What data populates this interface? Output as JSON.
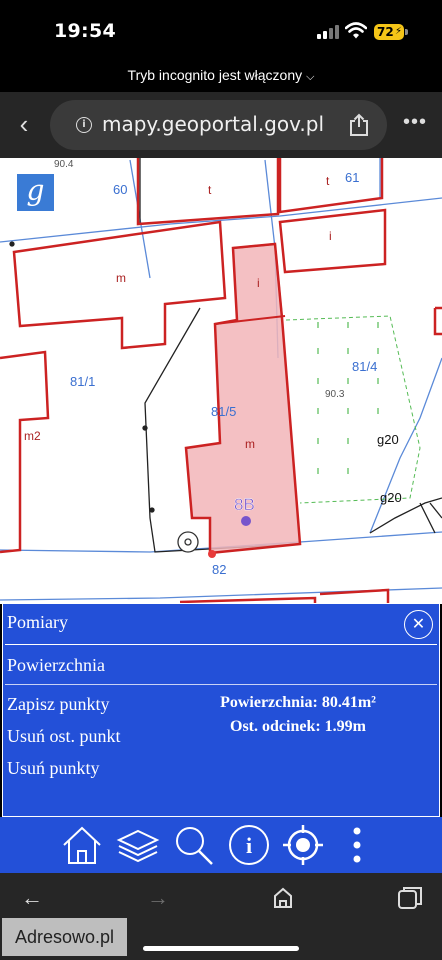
{
  "status_bar": {
    "time": "19:54",
    "battery_level": "72"
  },
  "browser": {
    "incognito_label": "Tryb incognito jest włączony",
    "url": "mapy.geoportal.gov.pl"
  },
  "map": {
    "logo_letter": "g",
    "labels": [
      {
        "id": "elev-904",
        "text": "90.4"
      },
      {
        "id": "parcel-60",
        "text": "60"
      },
      {
        "id": "t-left",
        "text": "t"
      },
      {
        "id": "t-right",
        "text": "t"
      },
      {
        "id": "parcel-61",
        "text": "61"
      },
      {
        "id": "i-right",
        "text": "i"
      },
      {
        "id": "m-top",
        "text": "m"
      },
      {
        "id": "i-selected",
        "text": "i"
      },
      {
        "id": "parcel-811",
        "text": "81/1"
      },
      {
        "id": "parcel-815",
        "text": "81/5"
      },
      {
        "id": "parcel-814",
        "text": "81/4"
      },
      {
        "id": "elev-903",
        "text": "90.3"
      },
      {
        "id": "m2",
        "text": "m2"
      },
      {
        "id": "m-selected",
        "text": "m"
      },
      {
        "id": "g20-a",
        "text": "g20"
      },
      {
        "id": "g20-b",
        "text": "g20"
      },
      {
        "id": "addr-8b",
        "text": "8B"
      },
      {
        "id": "parcel-82",
        "text": "82"
      }
    ],
    "colors": {
      "building": "#cc2222",
      "parcel_line": "#5b8ad8",
      "selection_fill": "#f2b5b8",
      "green_dash": "#55bb55"
    }
  },
  "panel": {
    "title": "Pomiary",
    "subtitle": "Powierzchnia",
    "actions": [
      "Zapisz punkty",
      "Usuń ost. punkt",
      "Usuń punkty"
    ],
    "area": "Powierzchnia: 80.41m²",
    "last_segment": "Ost. odcinek: 1.99m"
  },
  "toolbar": {
    "icons": [
      "home-icon",
      "layers-icon",
      "search-icon",
      "info-icon",
      "locate-icon",
      "more-vertical-icon"
    ],
    "info_glyph": "i"
  },
  "bottom_bar": {
    "watermark": "Adresowo.pl"
  }
}
